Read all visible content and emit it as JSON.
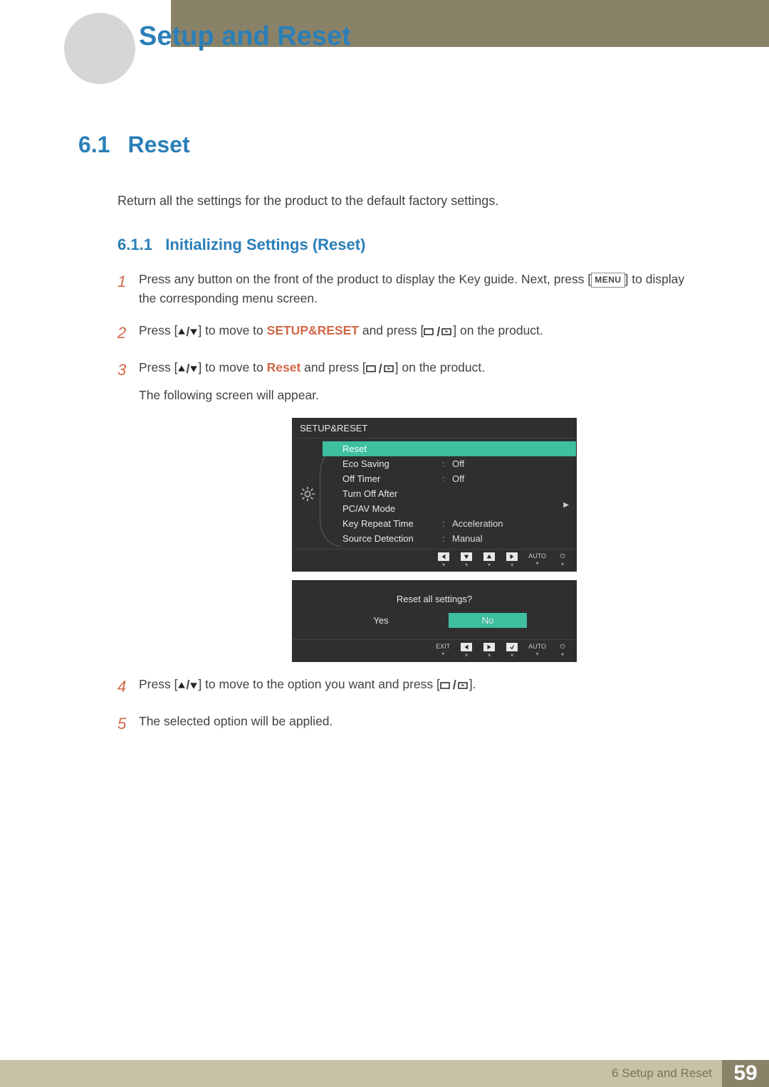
{
  "header": {
    "chapter_title": "Setup and Reset"
  },
  "section": {
    "number": "6.1",
    "title": "Reset",
    "intro": "Return all the settings for the product to the default factory settings."
  },
  "subsection": {
    "number": "6.1.1",
    "title": "Initializing Settings (Reset)"
  },
  "steps": {
    "s1": {
      "num": "1",
      "a": "Press any button on the front of the product to display the Key guide. Next, press [",
      "menu": "MENU",
      "b": "] to display the corresponding menu screen."
    },
    "s2": {
      "num": "2",
      "a": "Press [",
      "b": "] to move to ",
      "bold": "SETUP&RESET",
      "c": " and press [",
      "d": "] on the product."
    },
    "s3": {
      "num": "3",
      "a": "Press [",
      "b": "] to move to ",
      "bold": "Reset",
      "c": " and press [",
      "d": "] on the product.",
      "after": "The following screen will appear."
    },
    "s4": {
      "num": "4",
      "a": "Press [",
      "b": "] to move to the option you want and press [",
      "c": "]."
    },
    "s5": {
      "num": "5",
      "text": "The selected option will be applied."
    }
  },
  "osd1": {
    "title": "SETUP&RESET",
    "items": [
      {
        "key": "Reset",
        "val": "",
        "hl": true
      },
      {
        "key": "Eco Saving",
        "val": "Off"
      },
      {
        "key": "Off Timer",
        "val": "Off"
      },
      {
        "key": "Turn Off After",
        "val": ""
      },
      {
        "key": "PC/AV Mode",
        "val": ""
      },
      {
        "key": "Key Repeat Time",
        "val": "Acceleration"
      },
      {
        "key": "Source Detection",
        "val": "Manual"
      }
    ],
    "nav": {
      "auto": "AUTO"
    }
  },
  "osd2": {
    "msg": "Reset all settings?",
    "yes": "Yes",
    "no": "No",
    "exit": "EXIT",
    "auto": "AUTO"
  },
  "footer": {
    "chapter_ref": "6 Setup and Reset",
    "page": "59"
  }
}
